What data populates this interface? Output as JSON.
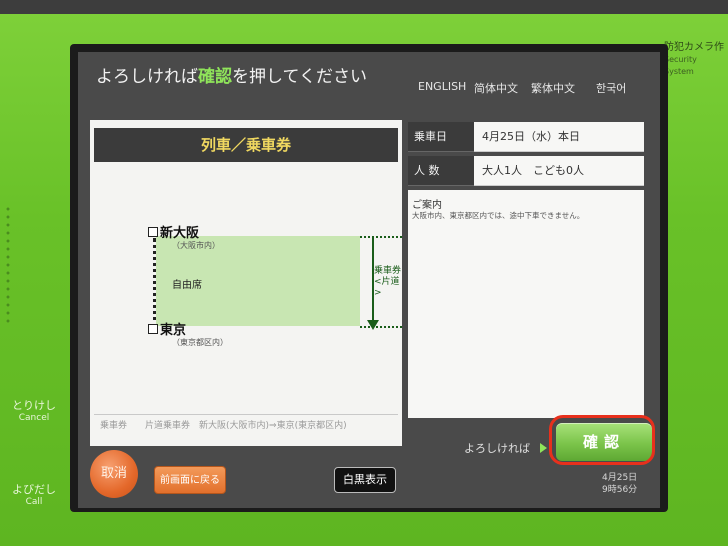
{
  "prompt": {
    "before": "よろしければ",
    "highlight": "確認",
    "after": "を押してください"
  },
  "languages": [
    "ENGLISH",
    "简体中文",
    "繁体中文",
    "한국어"
  ],
  "security": {
    "jp": "防犯カメラ作",
    "en": "Security System"
  },
  "bezel": {
    "cancel": {
      "jp": "とりけし",
      "en": "Cancel"
    },
    "call": {
      "jp": "よびだし",
      "en": "Call"
    }
  },
  "route": {
    "header": "列車／乗車券",
    "from": {
      "name": "新大阪",
      "area": "（大阪市内）"
    },
    "to": {
      "name": "東京",
      "area": "（東京都区内）"
    },
    "seat": "自由席",
    "ticket_type": [
      "乗車券",
      "<片道>"
    ],
    "summary": "乗車券　　片道乗車券　新大阪(大阪市内)⇒東京(東京都区内)"
  },
  "details": {
    "date_label": "乗車日",
    "date_value": "4月25日（水）本日",
    "people_label": "人 数",
    "people_value": "大人1人　こども0人",
    "notice_title": "ご案内",
    "notice_body": "大阪市内、東京都区内では、途中下車できません。"
  },
  "buttons": {
    "ok_prompt": "よろしければ",
    "confirm": "確認",
    "cancel": "取消",
    "back": "前画面に戻る",
    "bw": "白黒表示"
  },
  "clock": {
    "date": "4月25日",
    "time": "9時56分"
  },
  "colors": {
    "accent": "#8fe45a",
    "highlight_ring": "#e8301c",
    "machine_green": "#6cc52a"
  }
}
